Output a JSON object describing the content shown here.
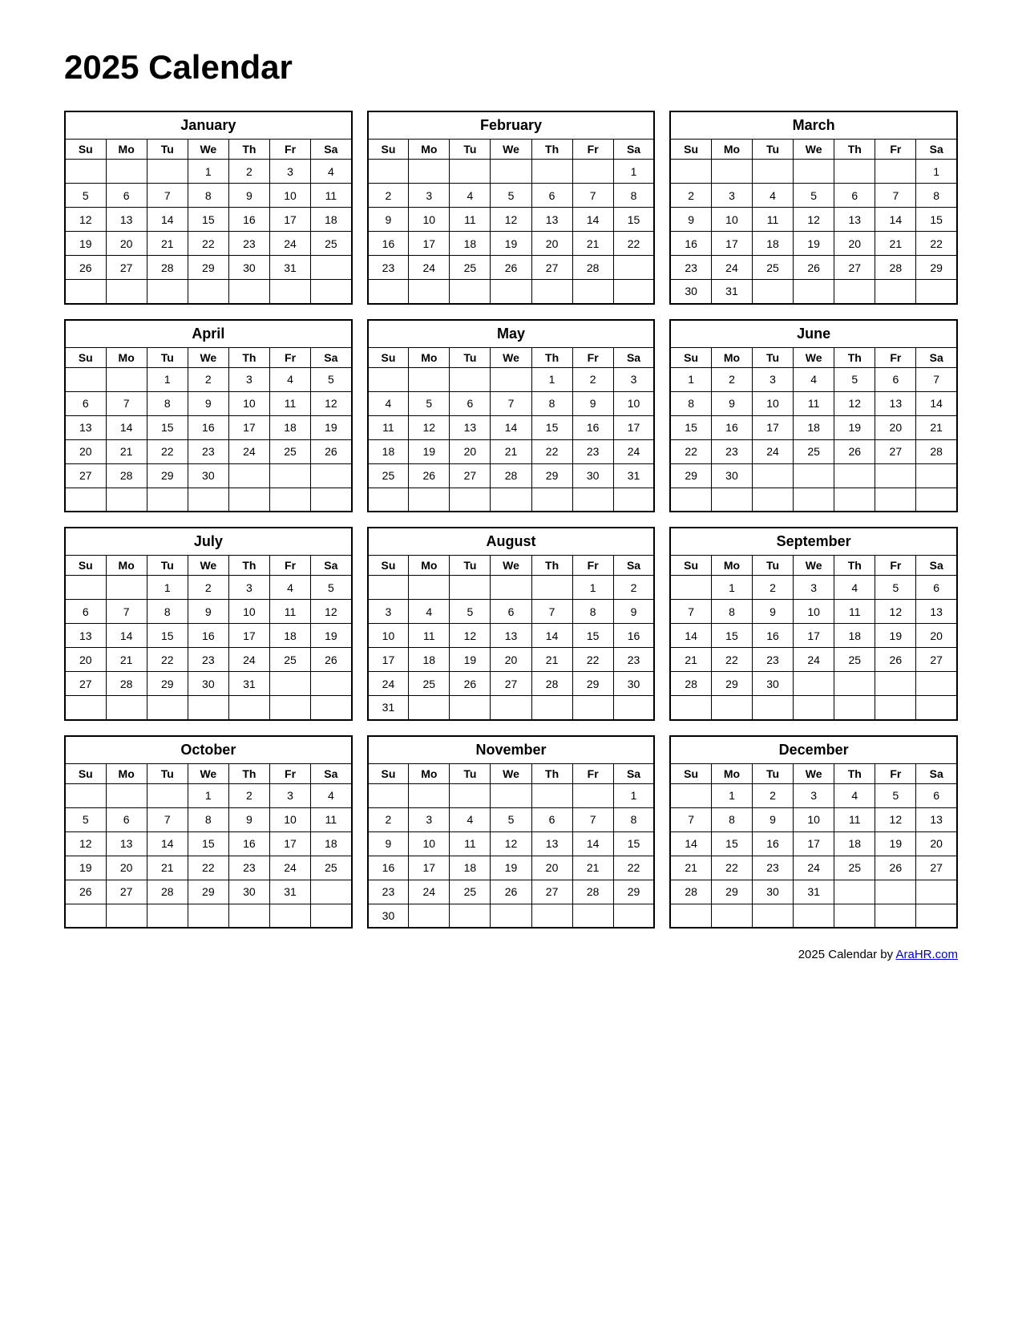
{
  "title": "2025 Calendar",
  "footer": {
    "text": "2025  Calendar by ",
    "link_text": "AraHR.com",
    "link_url": "#"
  },
  "months": [
    {
      "name": "January",
      "days_header": [
        "Su",
        "Mo",
        "Tu",
        "We",
        "Th",
        "Fr",
        "Sa"
      ],
      "weeks": [
        [
          "",
          "",
          "",
          "1",
          "2",
          "3",
          "4"
        ],
        [
          "5",
          "6",
          "7",
          "8",
          "9",
          "10",
          "11"
        ],
        [
          "12",
          "13",
          "14",
          "15",
          "16",
          "17",
          "18"
        ],
        [
          "19",
          "20",
          "21",
          "22",
          "23",
          "24",
          "25"
        ],
        [
          "26",
          "27",
          "28",
          "29",
          "30",
          "31",
          ""
        ],
        [
          "",
          "",
          "",
          "",
          "",
          "",
          ""
        ]
      ]
    },
    {
      "name": "February",
      "days_header": [
        "Su",
        "Mo",
        "Tu",
        "We",
        "Th",
        "Fr",
        "Sa"
      ],
      "weeks": [
        [
          "",
          "",
          "",
          "",
          "",
          "",
          "1"
        ],
        [
          "2",
          "3",
          "4",
          "5",
          "6",
          "7",
          "8"
        ],
        [
          "9",
          "10",
          "11",
          "12",
          "13",
          "14",
          "15"
        ],
        [
          "16",
          "17",
          "18",
          "19",
          "20",
          "21",
          "22"
        ],
        [
          "23",
          "24",
          "25",
          "26",
          "27",
          "28",
          ""
        ],
        [
          "",
          "",
          "",
          "",
          "",
          "",
          ""
        ]
      ]
    },
    {
      "name": "March",
      "days_header": [
        "Su",
        "Mo",
        "Tu",
        "We",
        "Th",
        "Fr",
        "Sa"
      ],
      "weeks": [
        [
          "",
          "",
          "",
          "",
          "",
          "",
          "1"
        ],
        [
          "2",
          "3",
          "4",
          "5",
          "6",
          "7",
          "8"
        ],
        [
          "9",
          "10",
          "11",
          "12",
          "13",
          "14",
          "15"
        ],
        [
          "16",
          "17",
          "18",
          "19",
          "20",
          "21",
          "22"
        ],
        [
          "23",
          "24",
          "25",
          "26",
          "27",
          "28",
          "29"
        ],
        [
          "30",
          "31",
          "",
          "",
          "",
          "",
          ""
        ]
      ]
    },
    {
      "name": "April",
      "days_header": [
        "Su",
        "Mo",
        "Tu",
        "We",
        "Th",
        "Fr",
        "Sa"
      ],
      "weeks": [
        [
          "",
          "",
          "1",
          "2",
          "3",
          "4",
          "5"
        ],
        [
          "6",
          "7",
          "8",
          "9",
          "10",
          "11",
          "12"
        ],
        [
          "13",
          "14",
          "15",
          "16",
          "17",
          "18",
          "19"
        ],
        [
          "20",
          "21",
          "22",
          "23",
          "24",
          "25",
          "26"
        ],
        [
          "27",
          "28",
          "29",
          "30",
          "",
          "",
          ""
        ],
        [
          "",
          "",
          "",
          "",
          "",
          "",
          ""
        ]
      ]
    },
    {
      "name": "May",
      "days_header": [
        "Su",
        "Mo",
        "Tu",
        "We",
        "Th",
        "Fr",
        "Sa"
      ],
      "weeks": [
        [
          "",
          "",
          "",
          "",
          "1",
          "2",
          "3"
        ],
        [
          "4",
          "5",
          "6",
          "7",
          "8",
          "9",
          "10"
        ],
        [
          "11",
          "12",
          "13",
          "14",
          "15",
          "16",
          "17"
        ],
        [
          "18",
          "19",
          "20",
          "21",
          "22",
          "23",
          "24"
        ],
        [
          "25",
          "26",
          "27",
          "28",
          "29",
          "30",
          "31"
        ],
        [
          "",
          "",
          "",
          "",
          "",
          "",
          ""
        ]
      ]
    },
    {
      "name": "June",
      "days_header": [
        "Su",
        "Mo",
        "Tu",
        "We",
        "Th",
        "Fr",
        "Sa"
      ],
      "weeks": [
        [
          "1",
          "2",
          "3",
          "4",
          "5",
          "6",
          "7"
        ],
        [
          "8",
          "9",
          "10",
          "11",
          "12",
          "13",
          "14"
        ],
        [
          "15",
          "16",
          "17",
          "18",
          "19",
          "20",
          "21"
        ],
        [
          "22",
          "23",
          "24",
          "25",
          "26",
          "27",
          "28"
        ],
        [
          "29",
          "30",
          "",
          "",
          "",
          "",
          ""
        ],
        [
          "",
          "",
          "",
          "",
          "",
          "",
          ""
        ]
      ]
    },
    {
      "name": "July",
      "days_header": [
        "Su",
        "Mo",
        "Tu",
        "We",
        "Th",
        "Fr",
        "Sa"
      ],
      "weeks": [
        [
          "",
          "",
          "1",
          "2",
          "3",
          "4",
          "5"
        ],
        [
          "6",
          "7",
          "8",
          "9",
          "10",
          "11",
          "12"
        ],
        [
          "13",
          "14",
          "15",
          "16",
          "17",
          "18",
          "19"
        ],
        [
          "20",
          "21",
          "22",
          "23",
          "24",
          "25",
          "26"
        ],
        [
          "27",
          "28",
          "29",
          "30",
          "31",
          "",
          ""
        ],
        [
          "",
          "",
          "",
          "",
          "",
          "",
          ""
        ]
      ]
    },
    {
      "name": "August",
      "days_header": [
        "Su",
        "Mo",
        "Tu",
        "We",
        "Th",
        "Fr",
        "Sa"
      ],
      "weeks": [
        [
          "",
          "",
          "",
          "",
          "",
          "1",
          "2"
        ],
        [
          "3",
          "4",
          "5",
          "6",
          "7",
          "8",
          "9"
        ],
        [
          "10",
          "11",
          "12",
          "13",
          "14",
          "15",
          "16"
        ],
        [
          "17",
          "18",
          "19",
          "20",
          "21",
          "22",
          "23"
        ],
        [
          "24",
          "25",
          "26",
          "27",
          "28",
          "29",
          "30"
        ],
        [
          "31",
          "",
          "",
          "",
          "",
          "",
          ""
        ]
      ]
    },
    {
      "name": "September",
      "days_header": [
        "Su",
        "Mo",
        "Tu",
        "We",
        "Th",
        "Fr",
        "Sa"
      ],
      "weeks": [
        [
          "",
          "1",
          "2",
          "3",
          "4",
          "5",
          "6"
        ],
        [
          "7",
          "8",
          "9",
          "10",
          "11",
          "12",
          "13"
        ],
        [
          "14",
          "15",
          "16",
          "17",
          "18",
          "19",
          "20"
        ],
        [
          "21",
          "22",
          "23",
          "24",
          "25",
          "26",
          "27"
        ],
        [
          "28",
          "29",
          "30",
          "",
          "",
          "",
          ""
        ],
        [
          "",
          "",
          "",
          "",
          "",
          "",
          ""
        ]
      ]
    },
    {
      "name": "October",
      "days_header": [
        "Su",
        "Mo",
        "Tu",
        "We",
        "Th",
        "Fr",
        "Sa"
      ],
      "weeks": [
        [
          "",
          "",
          "",
          "1",
          "2",
          "3",
          "4"
        ],
        [
          "5",
          "6",
          "7",
          "8",
          "9",
          "10",
          "11"
        ],
        [
          "12",
          "13",
          "14",
          "15",
          "16",
          "17",
          "18"
        ],
        [
          "19",
          "20",
          "21",
          "22",
          "23",
          "24",
          "25"
        ],
        [
          "26",
          "27",
          "28",
          "29",
          "30",
          "31",
          ""
        ],
        [
          "",
          "",
          "",
          "",
          "",
          "",
          ""
        ]
      ]
    },
    {
      "name": "November",
      "days_header": [
        "Su",
        "Mo",
        "Tu",
        "We",
        "Th",
        "Fr",
        "Sa"
      ],
      "weeks": [
        [
          "",
          "",
          "",
          "",
          "",
          "",
          "1"
        ],
        [
          "2",
          "3",
          "4",
          "5",
          "6",
          "7",
          "8"
        ],
        [
          "9",
          "10",
          "11",
          "12",
          "13",
          "14",
          "15"
        ],
        [
          "16",
          "17",
          "18",
          "19",
          "20",
          "21",
          "22"
        ],
        [
          "23",
          "24",
          "25",
          "26",
          "27",
          "28",
          "29"
        ],
        [
          "30",
          "",
          "",
          "",
          "",
          "",
          ""
        ]
      ]
    },
    {
      "name": "December",
      "days_header": [
        "Su",
        "Mo",
        "Tu",
        "We",
        "Th",
        "Fr",
        "Sa"
      ],
      "weeks": [
        [
          "",
          "1",
          "2",
          "3",
          "4",
          "5",
          "6"
        ],
        [
          "7",
          "8",
          "9",
          "10",
          "11",
          "12",
          "13"
        ],
        [
          "14",
          "15",
          "16",
          "17",
          "18",
          "19",
          "20"
        ],
        [
          "21",
          "22",
          "23",
          "24",
          "25",
          "26",
          "27"
        ],
        [
          "28",
          "29",
          "30",
          "31",
          "",
          "",
          ""
        ],
        [
          "",
          "",
          "",
          "",
          "",
          "",
          ""
        ]
      ]
    }
  ]
}
